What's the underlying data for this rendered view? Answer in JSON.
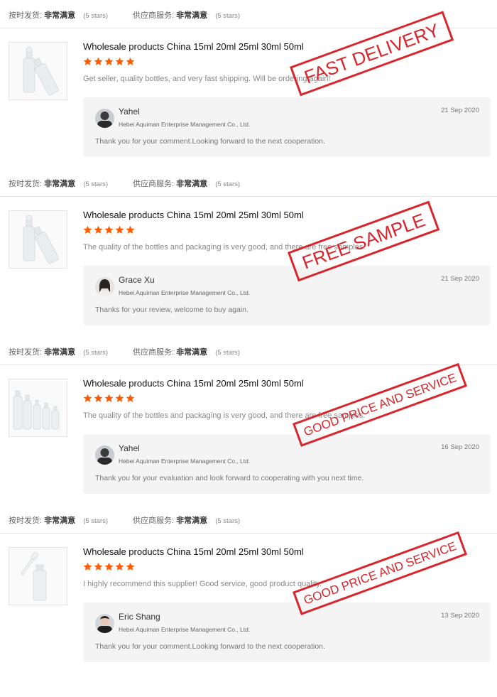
{
  "colors": {
    "star": "#ff5a00",
    "stamp": "#d8262c"
  },
  "reviews": [
    {
      "rating_labels": {
        "delivery_label": "按时发货:",
        "delivery_value": "非常满意",
        "delivery_stars": "(5 stars)",
        "service_label": "供应商服务:",
        "service_value": "非常满意",
        "service_stars": "(5 stars)"
      },
      "thumb_icon": "single-bottle-icon",
      "title": "Wholesale products China 15ml 20ml 25ml 30ml 50ml",
      "stars": 5,
      "comment": "Get seller, quality bottles, and very fast shipping. Will be ordering again!",
      "stamp": "FAST DELIVERY",
      "reply": {
        "name": "Yahel",
        "company": "Hebei Aquiman Enterprise Management Co., Ltd.",
        "date": "21 Sep 2020",
        "text": "Thank you for your comment.Looking forward to the next cooperation."
      }
    },
    {
      "rating_labels": {
        "delivery_label": "按时发货:",
        "delivery_value": "非常满意",
        "delivery_stars": "(5 stars)",
        "service_label": "供应商服务:",
        "service_value": "非常满意",
        "service_stars": "(5 stars)"
      },
      "thumb_icon": "single-bottle-icon",
      "title": "Wholesale products China 15ml 20ml 25ml 30ml 50ml",
      "stars": 5,
      "comment": "The quality of the bottles and packaging is very good, and there are free samples.",
      "stamp": "FREE SAMPLE",
      "reply": {
        "name": "Grace Xu",
        "company": "Hebei Aquiman Enterprise Management Co., Ltd.",
        "date": "21 Sep 2020",
        "text": "Thanks for your review, welcome to buy again."
      }
    },
    {
      "rating_labels": {
        "delivery_label": "按时发货:",
        "delivery_value": "非常满意",
        "delivery_stars": "(5 stars)",
        "service_label": "供应商服务:",
        "service_value": "非常满意",
        "service_stars": "(5 stars)"
      },
      "thumb_icon": "bottle-set-icon",
      "title": "Wholesale products China 15ml 20ml 25ml 30ml 50ml",
      "stars": 5,
      "comment": "The quality of the bottles and packaging is very good, and there are free samples.",
      "stamp": "GOOD PRICE AND SERVICE",
      "reply": {
        "name": "Yahel",
        "company": "Hebei Aquiman Enterprise Management Co., Ltd.",
        "date": "16 Sep 2020",
        "text": "Thank you for your evaluation and look forward to cooperating with you next time."
      }
    },
    {
      "rating_labels": {
        "delivery_label": "按时发货:",
        "delivery_value": "非常满意",
        "delivery_stars": "(5 stars)",
        "service_label": "供应商服务:",
        "service_value": "非常满意",
        "service_stars": "(5 stars)"
      },
      "thumb_icon": "dropper-bottle-icon",
      "title": "Wholesale products China 15ml 20ml 25ml 30ml 50ml",
      "stars": 5,
      "comment": "I highly recommend this supplier! Good service, good product quality.",
      "stamp": "GOOD PRICE AND SERVICE",
      "reply": {
        "name": "Eric Shang",
        "company": "Hebei Aquiman Enterprise Management Co., Ltd.",
        "date": "13 Sep 2020",
        "text": "Thank you for your comment.Looking forward to the next cooperation."
      }
    }
  ]
}
